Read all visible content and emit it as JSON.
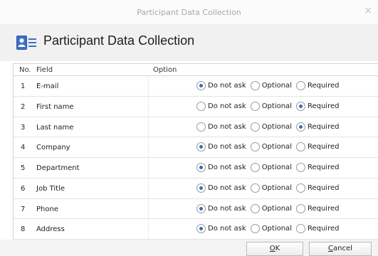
{
  "window": {
    "title": "Participant Data Collection",
    "close_glyph": "×"
  },
  "header": {
    "icon": "contact-card-icon",
    "title": "Participant Data Collection"
  },
  "table": {
    "columns": {
      "no": "No.",
      "field": "Field",
      "option": "Option"
    },
    "option_labels": [
      "Do not ask",
      "Optional",
      "Required"
    ],
    "rows": [
      {
        "no": "1",
        "field": "E-mail",
        "selected": "Do not ask"
      },
      {
        "no": "2",
        "field": "First name",
        "selected": "Required"
      },
      {
        "no": "3",
        "field": "Last name",
        "selected": "Required"
      },
      {
        "no": "4",
        "field": "Company",
        "selected": "Do not ask"
      },
      {
        "no": "5",
        "field": "Department",
        "selected": "Do not ask"
      },
      {
        "no": "6",
        "field": "Job Title",
        "selected": "Do not ask"
      },
      {
        "no": "7",
        "field": "Phone",
        "selected": "Do not ask"
      },
      {
        "no": "8",
        "field": "Address",
        "selected": "Do not ask"
      }
    ]
  },
  "buttons": {
    "ok": {
      "label_rest": "K",
      "mnemonic": "O"
    },
    "cancel": {
      "label_rest": "ancel",
      "mnemonic": "C"
    }
  },
  "colors": {
    "accent": "#3e67b8",
    "header_bg": "#f1f1f1"
  }
}
